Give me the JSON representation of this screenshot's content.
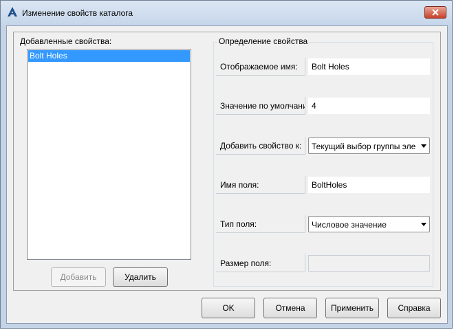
{
  "window": {
    "title": "Изменение свойств каталога"
  },
  "left_panel": {
    "label": "Добавленные свойства:",
    "items": [
      "Bolt Holes"
    ],
    "add_button": "Добавить",
    "delete_button": "Удалить"
  },
  "definition": {
    "title": "Определение свойства",
    "display_name": {
      "label": "Отображаемое имя:",
      "value": "Bolt Holes"
    },
    "default_value": {
      "label": "Значение по умолчани",
      "value": "4"
    },
    "add_property_to": {
      "label": "Добавить свойство к:",
      "value": "Текущий выбор группы эле"
    },
    "field_name": {
      "label": "Имя поля:",
      "value": "BoltHoles"
    },
    "field_type": {
      "label": "Тип поля:",
      "value": "Числовое значение"
    },
    "field_size": {
      "label": "Размер поля:",
      "value": ""
    }
  },
  "footer": {
    "ok": "OK",
    "cancel": "Отмена",
    "apply": "Применить",
    "help": "Справка"
  }
}
